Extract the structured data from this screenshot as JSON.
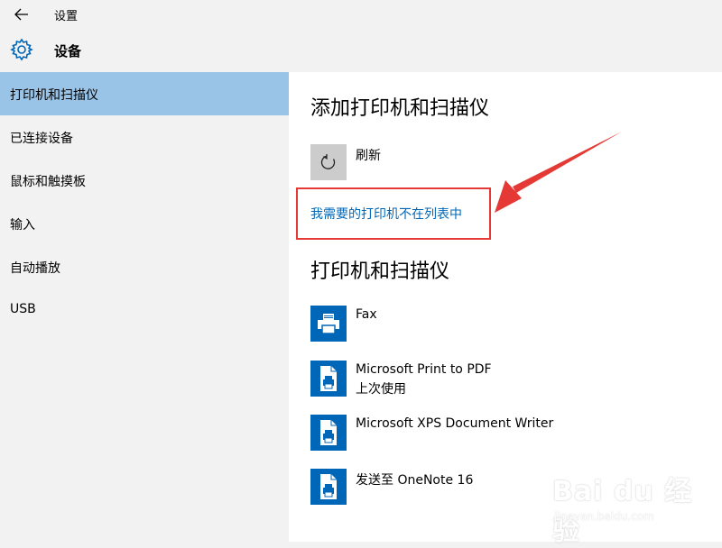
{
  "window": {
    "title": "设置"
  },
  "header": {
    "title": "设备"
  },
  "sidebar": {
    "items": [
      {
        "label": "打印机和扫描仪",
        "active": true
      },
      {
        "label": "已连接设备"
      },
      {
        "label": "鼠标和触摸板"
      },
      {
        "label": "输入"
      },
      {
        "label": "自动播放"
      },
      {
        "label": "USB"
      }
    ]
  },
  "main": {
    "add_heading": "添加打印机和扫描仪",
    "refresh_label": "刷新",
    "missing_printer_link": "我需要的打印机不在列表中",
    "printers_heading": "打印机和扫描仪",
    "printers": [
      {
        "name": "Fax",
        "status": ""
      },
      {
        "name": "Microsoft Print to PDF",
        "status": "上次使用"
      },
      {
        "name": "Microsoft XPS Document Writer",
        "status": ""
      },
      {
        "name": "发送至 OneNote 16",
        "status": ""
      }
    ]
  },
  "watermark": {
    "brand": "Bai du 经验",
    "url": "jingyan.baidu.com"
  },
  "colors": {
    "accent": "#0067b8",
    "active_item": "#99c4e8",
    "annotation": "#e53935"
  },
  "icons": {
    "back": "back-arrow-icon",
    "settings": "gear-icon",
    "refresh": "refresh-icon",
    "fax": "fax-printer-icon",
    "document_printer": "document-printer-icon"
  }
}
